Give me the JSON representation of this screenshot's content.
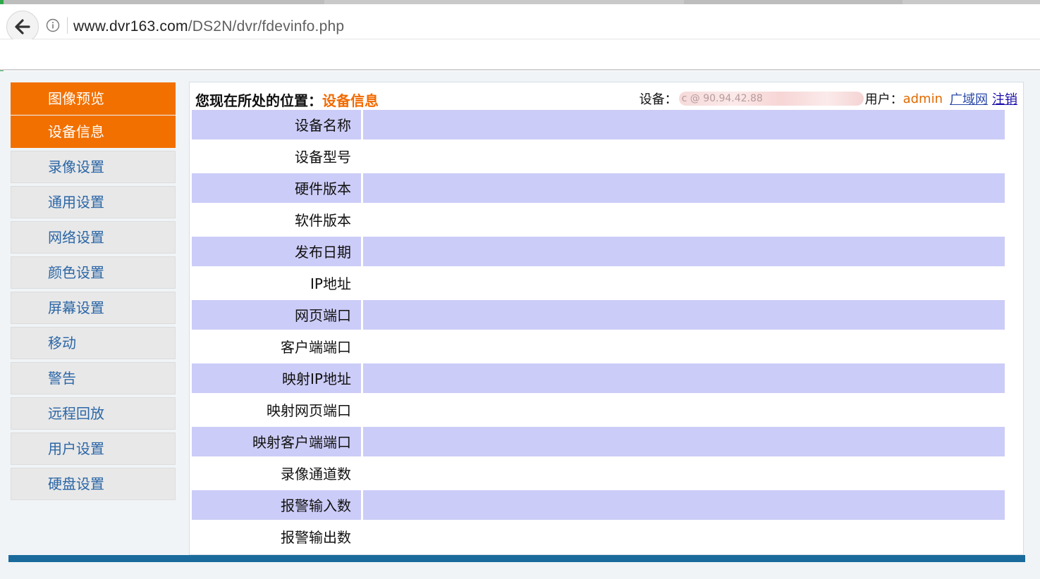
{
  "browser": {
    "url_host": "www.dvr163.com",
    "url_path": "/DS2N/dvr/fdevinfo.php"
  },
  "sidebar": {
    "items": [
      {
        "label": "图像预览",
        "active": true
      },
      {
        "label": "设备信息",
        "active": true
      },
      {
        "label": "录像设置",
        "active": false
      },
      {
        "label": "通用设置",
        "active": false
      },
      {
        "label": "网络设置",
        "active": false
      },
      {
        "label": "颜色设置",
        "active": false
      },
      {
        "label": "屏幕设置",
        "active": false
      },
      {
        "label": "移动",
        "active": false
      },
      {
        "label": "警告",
        "active": false
      },
      {
        "label": "远程回放",
        "active": false
      },
      {
        "label": "用户设置",
        "active": false
      },
      {
        "label": "硬盘设置",
        "active": false
      }
    ]
  },
  "header": {
    "location_prefix": "您现在所处的位置：",
    "location_current": "设备信息",
    "device_label": "设备：",
    "device_value": "c                    @             90.94.42.88",
    "user_label": "用户：",
    "user_name": "admin",
    "wan_link": "广域网",
    "logout_link": "注销"
  },
  "device_info": {
    "rows": [
      {
        "label": "设备名称",
        "value": ""
      },
      {
        "label": "设备型号",
        "value": ""
      },
      {
        "label": "硬件版本",
        "value": ""
      },
      {
        "label": "软件版本",
        "value": ""
      },
      {
        "label": "发布日期",
        "value": ""
      },
      {
        "label": "IP地址",
        "value": ""
      },
      {
        "label": "网页端口",
        "value": ""
      },
      {
        "label": "客户端端口",
        "value": ""
      },
      {
        "label": "映射IP地址",
        "value": ""
      },
      {
        "label": "映射网页端口",
        "value": ""
      },
      {
        "label": "映射客户端端口",
        "value": ""
      },
      {
        "label": "录像通道数",
        "value": ""
      },
      {
        "label": "报警输入数",
        "value": ""
      },
      {
        "label": "报警输出数",
        "value": ""
      }
    ]
  },
  "colors": {
    "accent": "#f27000",
    "row_shade": "#ccccf8",
    "nav_link": "#2b66a6",
    "footer": "#1a6b9c"
  }
}
